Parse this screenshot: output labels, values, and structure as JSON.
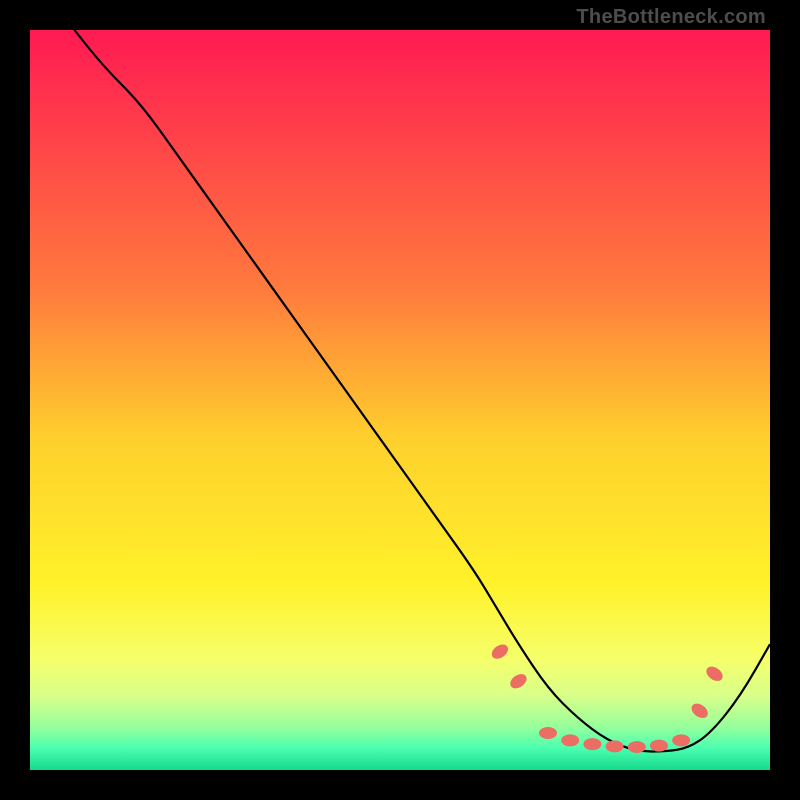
{
  "watermark": "TheBottleneck.com",
  "chart_data": {
    "type": "line",
    "title": "",
    "xlabel": "",
    "ylabel": "",
    "xlim": [
      0,
      100
    ],
    "ylim": [
      0,
      100
    ],
    "gradient_stops": [
      {
        "offset": 0,
        "color": "#ff1a52"
      },
      {
        "offset": 0.35,
        "color": "#ff7a3d"
      },
      {
        "offset": 0.55,
        "color": "#ffcf2d"
      },
      {
        "offset": 0.75,
        "color": "#fff22a"
      },
      {
        "offset": 0.85,
        "color": "#f6ff6a"
      },
      {
        "offset": 0.9,
        "color": "#d8ff8a"
      },
      {
        "offset": 0.94,
        "color": "#9aff9a"
      },
      {
        "offset": 0.97,
        "color": "#4dffb0"
      },
      {
        "offset": 1.0,
        "color": "#15d98c"
      }
    ],
    "series": [
      {
        "name": "bottleneck-curve",
        "x": [
          6,
          10,
          15,
          20,
          25,
          30,
          35,
          40,
          45,
          50,
          55,
          60,
          63,
          66,
          70,
          74,
          78,
          82,
          86,
          89,
          92,
          96,
          100
        ],
        "y": [
          100,
          95,
          90,
          83,
          76,
          69,
          62,
          55,
          48,
          41,
          34,
          27,
          22,
          17,
          11,
          7,
          4,
          2.5,
          2.5,
          3,
          5,
          10,
          17
        ]
      }
    ],
    "markers": {
      "name": "highlight-points",
      "points": [
        {
          "x": 63.5,
          "y": 16,
          "rx": 6,
          "ry": 9,
          "rot": 55
        },
        {
          "x": 66,
          "y": 12,
          "rx": 6,
          "ry": 9,
          "rot": 55
        },
        {
          "x": 70,
          "y": 5,
          "rx": 9,
          "ry": 6,
          "rot": 0
        },
        {
          "x": 73,
          "y": 4,
          "rx": 9,
          "ry": 6,
          "rot": 0
        },
        {
          "x": 76,
          "y": 3.5,
          "rx": 9,
          "ry": 6,
          "rot": 0
        },
        {
          "x": 79,
          "y": 3.2,
          "rx": 9,
          "ry": 6,
          "rot": 0
        },
        {
          "x": 82,
          "y": 3.1,
          "rx": 9,
          "ry": 6,
          "rot": 0
        },
        {
          "x": 85,
          "y": 3.3,
          "rx": 9,
          "ry": 6,
          "rot": 0
        },
        {
          "x": 88,
          "y": 4,
          "rx": 9,
          "ry": 6,
          "rot": 0
        },
        {
          "x": 90.5,
          "y": 8,
          "rx": 6,
          "ry": 9,
          "rot": -55
        },
        {
          "x": 92.5,
          "y": 13,
          "rx": 6,
          "ry": 9,
          "rot": -55
        }
      ]
    }
  }
}
